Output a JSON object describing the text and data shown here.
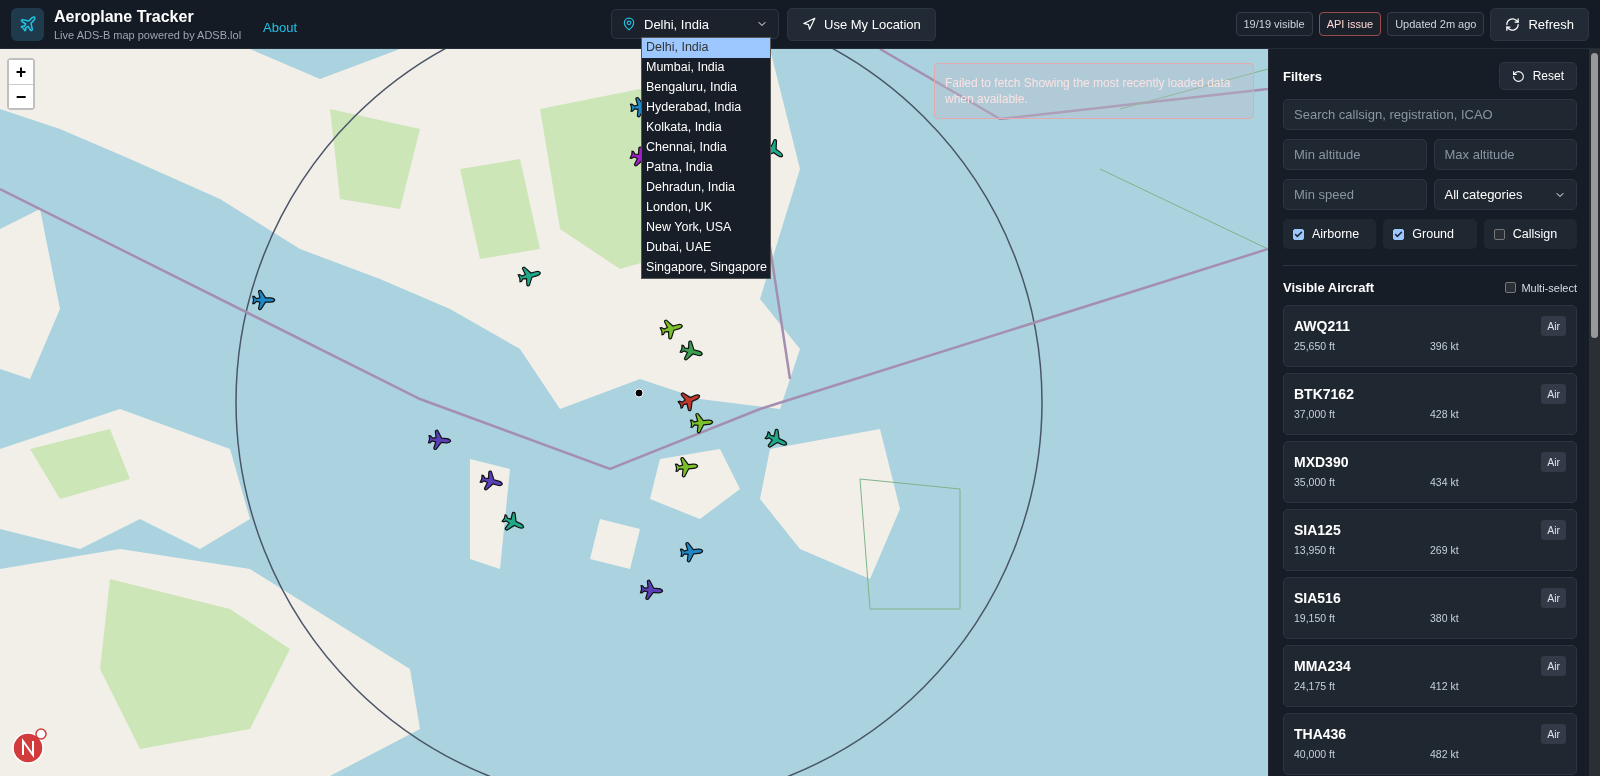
{
  "app": {
    "title": "Aeroplane Tracker",
    "subtitle": "Live ADS-B map powered by ADSB.lol",
    "about_link": "About"
  },
  "location_select": {
    "value": "Delhi, India",
    "expanded": true,
    "options": [
      {
        "label": "Delhi, India",
        "selected": true
      },
      {
        "label": "Mumbai, India",
        "selected": false
      },
      {
        "label": "Bengaluru, India",
        "selected": false
      },
      {
        "label": "Hyderabad, India",
        "selected": false
      },
      {
        "label": "Kolkata, India",
        "selected": false
      },
      {
        "label": "Chennai, India",
        "selected": false
      },
      {
        "label": "Patna, India",
        "selected": false
      },
      {
        "label": "Dehradun, India",
        "selected": false
      },
      {
        "label": "London, UK",
        "selected": false
      },
      {
        "label": "New York, USA",
        "selected": false
      },
      {
        "label": "Dubai, UAE",
        "selected": false
      },
      {
        "label": "Singapore, Singapore",
        "selected": false
      }
    ]
  },
  "use_location_button": "Use My Location",
  "status_badges": [
    {
      "label": "19/19 visible",
      "kind": "info"
    },
    {
      "label": "API issue",
      "kind": "error"
    },
    {
      "label": "Updated 2m ago",
      "kind": "info"
    }
  ],
  "refresh_button": "Refresh",
  "map": {
    "zoom_in": "+",
    "zoom_out": "−",
    "alert": "Failed to fetch Showing the most recently loaded data when available."
  },
  "filters": {
    "title": "Filters",
    "reset_button": "Reset",
    "search": {
      "placeholder": "Search callsign, registration, ICAO"
    },
    "min_altitude": {
      "placeholder": "Min altitude"
    },
    "max_altitude": {
      "placeholder": "Max altitude"
    },
    "min_speed": {
      "placeholder": "Min speed"
    },
    "category": {
      "value": "All categories"
    },
    "toggles": [
      {
        "label": "Airborne",
        "checked": true
      },
      {
        "label": "Ground",
        "checked": true
      },
      {
        "label": "Callsign",
        "checked": false
      }
    ]
  },
  "aircraft_list": {
    "title": "Visible Aircraft",
    "multi_select": {
      "label": "Multi-select",
      "checked": false
    },
    "items": [
      {
        "callsign": "AWQ211",
        "altitude": "25,650 ft",
        "speed": "396 kt",
        "status": "Air"
      },
      {
        "callsign": "BTK7162",
        "altitude": "37,000 ft",
        "speed": "428 kt",
        "status": "Air"
      },
      {
        "callsign": "MXD390",
        "altitude": "35,000 ft",
        "speed": "434 kt",
        "status": "Air"
      },
      {
        "callsign": "SIA125",
        "altitude": "13,950 ft",
        "speed": "269 kt",
        "status": "Air"
      },
      {
        "callsign": "SIA516",
        "altitude": "19,150 ft",
        "speed": "380 kt",
        "status": "Air"
      },
      {
        "callsign": "MMA234",
        "altitude": "24,175 ft",
        "speed": "412 kt",
        "status": "Air"
      },
      {
        "callsign": "THA436",
        "altitude": "40,000 ft",
        "speed": "482 kt",
        "status": "Air"
      }
    ]
  }
}
